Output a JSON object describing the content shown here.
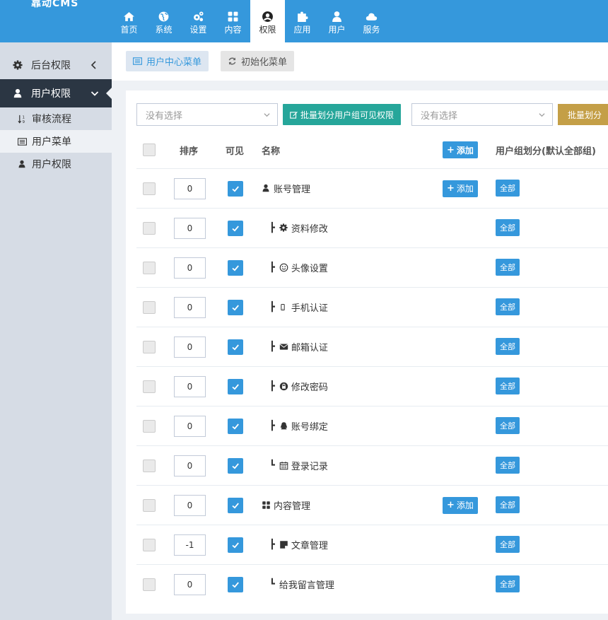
{
  "app": {
    "logo": "靠动CMS"
  },
  "topnav": {
    "items": [
      {
        "label": "首页",
        "icon": "home-icon"
      },
      {
        "label": "系统",
        "icon": "globe-icon"
      },
      {
        "label": "设置",
        "icon": "cogs-icon"
      },
      {
        "label": "内容",
        "icon": "grid-icon"
      },
      {
        "label": "权限",
        "icon": "user-circle-icon",
        "active": true
      },
      {
        "label": "应用",
        "icon": "puzzle-icon"
      },
      {
        "label": "用户",
        "icon": "user-icon"
      },
      {
        "label": "服务",
        "icon": "cloud-icon"
      }
    ]
  },
  "sidebar": {
    "sections": [
      {
        "label": "后台权限",
        "icon": "gear-icon",
        "expanded": false
      },
      {
        "label": "用户权限",
        "icon": "user-icon",
        "expanded": true
      }
    ],
    "sub_items": [
      {
        "label": "审核流程",
        "icon": "sort-numeric-icon"
      },
      {
        "label": "用户菜单",
        "icon": "list-icon",
        "active": true
      },
      {
        "label": "用户权限",
        "icon": "user-icon"
      }
    ]
  },
  "toolbar": {
    "tabs": [
      {
        "label": "用户中心菜单",
        "active": true
      },
      {
        "label": "初始化菜单"
      }
    ]
  },
  "filters": {
    "select1_placeholder": "没有选择",
    "btn1_label": "批量划分用户组可见权限",
    "select2_placeholder": "没有选择",
    "btn2_label": "批量划分"
  },
  "table": {
    "headers": {
      "order": "排序",
      "visible": "可见",
      "name": "名称",
      "add": "添加",
      "group": "用户组划分(默认全部组)"
    },
    "add_label": "添加",
    "all_label": "全部",
    "rows": [
      {
        "order": "0",
        "name": "账号管理",
        "prefix": "",
        "icon": "user-icon",
        "has_add": true
      },
      {
        "order": "0",
        "name": "资料修改",
        "prefix": "┣",
        "icon": "gear-icon",
        "has_add": false
      },
      {
        "order": "0",
        "name": "头像设置",
        "prefix": "┣",
        "icon": "smile-icon",
        "has_add": false
      },
      {
        "order": "0",
        "name": "手机认证",
        "prefix": "┣",
        "icon": "mobile-icon",
        "has_add": false
      },
      {
        "order": "0",
        "name": "邮箱认证",
        "prefix": "┣",
        "icon": "envelope-icon",
        "has_add": false
      },
      {
        "order": "0",
        "name": "修改密码",
        "prefix": "┣",
        "icon": "lock-icon",
        "has_add": false
      },
      {
        "order": "0",
        "name": "账号绑定",
        "prefix": "┣",
        "icon": "qq-icon",
        "has_add": false
      },
      {
        "order": "0",
        "name": "登录记录",
        "prefix": "┗",
        "icon": "calendar-icon",
        "has_add": false
      },
      {
        "order": "0",
        "name": "内容管理",
        "prefix": "",
        "icon": "grid-icon",
        "has_add": true
      },
      {
        "order": "-1",
        "name": "文章管理",
        "prefix": "┣",
        "icon": "sticky-note-icon",
        "has_add": false
      },
      {
        "order": "0",
        "name": "给我留言管理",
        "prefix": "┗",
        "icon": "",
        "has_add": false
      }
    ]
  },
  "colors": {
    "primary": "#3598dc",
    "green": "#26a69a",
    "yellow": "#c49f47",
    "sidebar_dark": "#2b3643",
    "sidebar": "#d6dce5"
  }
}
